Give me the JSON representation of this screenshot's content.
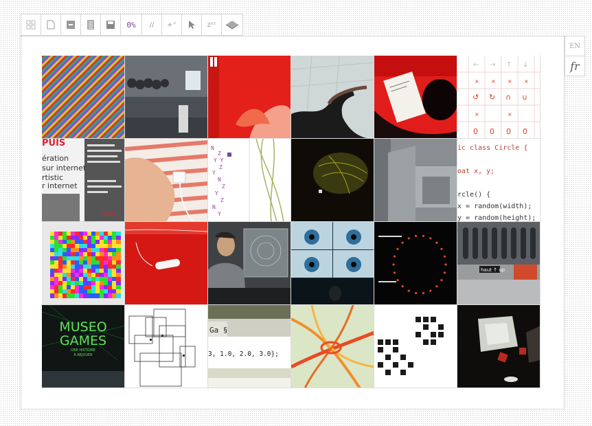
{
  "toolbar": {
    "items": [
      {
        "id": "select",
        "icon": "grid-select-icon"
      },
      {
        "id": "new",
        "icon": "page-icon"
      },
      {
        "id": "minimize",
        "icon": "minus-square-icon"
      },
      {
        "id": "list",
        "icon": "list-icon"
      },
      {
        "id": "save",
        "icon": "save-icon"
      },
      {
        "id": "zoom",
        "label": "0%"
      },
      {
        "id": "comment",
        "label": "//"
      },
      {
        "id": "add",
        "label": "+⁺"
      },
      {
        "id": "cursor",
        "icon": "arrow-cursor-icon"
      },
      {
        "id": "sleep",
        "label": "zᶻᶻ"
      },
      {
        "id": "layers",
        "icon": "layers-icon"
      }
    ]
  },
  "languages": {
    "en": "EN",
    "fr": "fr"
  },
  "tiles": {
    "t09": {
      "lines": [
        "PUIS",
        "ération",
        "sur internet",
        "rtistic",
        "r internet",
        "RENT N"
      ]
    },
    "t12": {
      "lines": [
        "ic class Circle {",
        "",
        "oat x, y;",
        "",
        "rcle() {",
        "x = random(width);",
        "y = random(height);"
      ]
    },
    "t17": {
      "lines": [
        "haut ↑ up"
      ]
    },
    "t18": {
      "lines": [
        "MUSEO",
        "GAMES",
        "UNE HISTOIRE",
        "À REJOUER"
      ]
    },
    "t20": {
      "lines": [
        "Ga §",
        "3, 1.0, 2.0, 3.0};"
      ]
    }
  }
}
